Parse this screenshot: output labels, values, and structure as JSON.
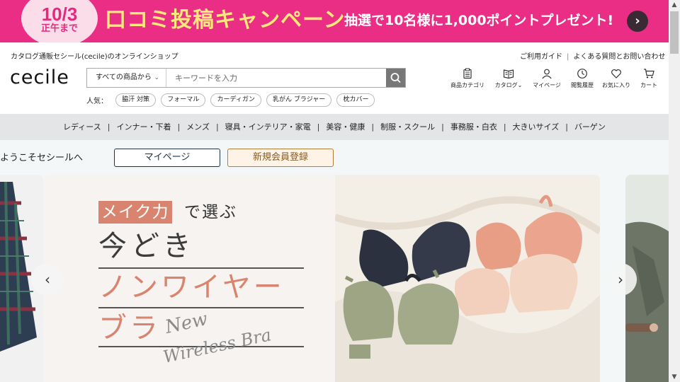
{
  "promo": {
    "date": "10/3",
    "deadline": "正午まで",
    "title": "口コミ投稿キャンペーン",
    "subtitle": "抽選で10名様に1,000ポイントプレゼント!",
    "arrow": "›"
  },
  "header": {
    "shop_description": "カタログ通販セシール(cecile)のオンラインショップ",
    "links": [
      "ご利用ガイド",
      "よくある質問とお問い合わせ"
    ],
    "logo": "cecile"
  },
  "search": {
    "category": "すべての商品から",
    "placeholder": "キーワードを入力"
  },
  "popular": {
    "label": "人気：",
    "chips": [
      "脇汗 対策",
      "フォーマル",
      "カーディガン",
      "乳がん ブラジャー",
      "枕カバー"
    ]
  },
  "nav_icons": [
    {
      "label": "商品カテゴリ",
      "icon": "clipboard-icon"
    },
    {
      "label": "カタログ",
      "icon": "book-icon"
    },
    {
      "label": "マイページ",
      "icon": "person-icon"
    },
    {
      "label": "閲覧履歴",
      "icon": "clock-icon"
    },
    {
      "label": "お気に入り",
      "icon": "heart-icon"
    },
    {
      "label": "カート",
      "icon": "cart-icon"
    }
  ],
  "categories": [
    "レディース",
    "インナー・下着",
    "メンズ",
    "寝具・インテリア・家電",
    "美容・健康",
    "制服・スクール",
    "事務服・白衣",
    "大きいサイズ",
    "バーゲン"
  ],
  "welcome": {
    "text": "ようこそセシールへ",
    "mypage_button": "マイページ",
    "register_button": "新規会員登録"
  },
  "slide": {
    "tag_highlight": "メイク力",
    "tag_rest": "で選ぶ",
    "line1": "今どき",
    "line2": "ノンワイヤー",
    "line3": "ブラ",
    "script1": "New",
    "script2": "Wireless Bra"
  },
  "colors": {
    "promo_pink": "#ea2e86",
    "promo_yellow": "#ffe97a",
    "accent_salmon": "#d8846e",
    "navy": "#1f3347"
  }
}
